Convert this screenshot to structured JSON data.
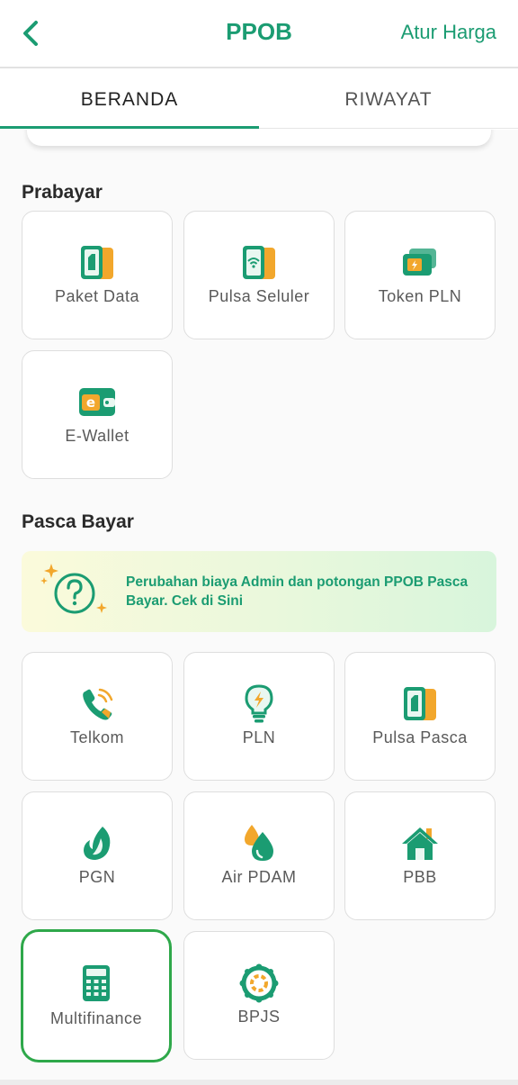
{
  "header": {
    "title": "PPOB",
    "action_label": "Atur Harga",
    "back_icon": "chevron-left-icon"
  },
  "tabs": [
    {
      "label": "BERANDA",
      "active": true
    },
    {
      "label": "RIWAYAT",
      "active": false
    }
  ],
  "prabayar": {
    "title": "Prabayar",
    "items": [
      {
        "label": "Paket Data",
        "icon": "sim-card-icon"
      },
      {
        "label": "Pulsa Seluler",
        "icon": "phone-signal-icon"
      },
      {
        "label": "Token PLN",
        "icon": "token-card-icon"
      },
      {
        "label": "E-Wallet",
        "icon": "wallet-icon"
      }
    ]
  },
  "pascabayar": {
    "title": "Pasca Bayar",
    "banner": "Perubahan biaya Admin dan potongan PPOB Pasca Bayar. Cek di Sini",
    "items": [
      {
        "label": "Telkom",
        "icon": "telephone-icon"
      },
      {
        "label": "PLN",
        "icon": "lightbulb-icon"
      },
      {
        "label": "Pulsa Pasca",
        "icon": "sim-card-icon"
      },
      {
        "label": "PGN",
        "icon": "gas-flame-icon"
      },
      {
        "label": "Air PDAM",
        "icon": "water-drop-icon"
      },
      {
        "label": "PBB",
        "icon": "house-icon"
      },
      {
        "label": "Multifinance",
        "icon": "calculator-icon",
        "selected": true
      },
      {
        "label": "BPJS",
        "icon": "bpjs-logo-icon"
      }
    ]
  },
  "colors": {
    "primary": "#1b9c72",
    "accent_orange": "#f2a72c",
    "selected_border": "#2ea84a"
  }
}
